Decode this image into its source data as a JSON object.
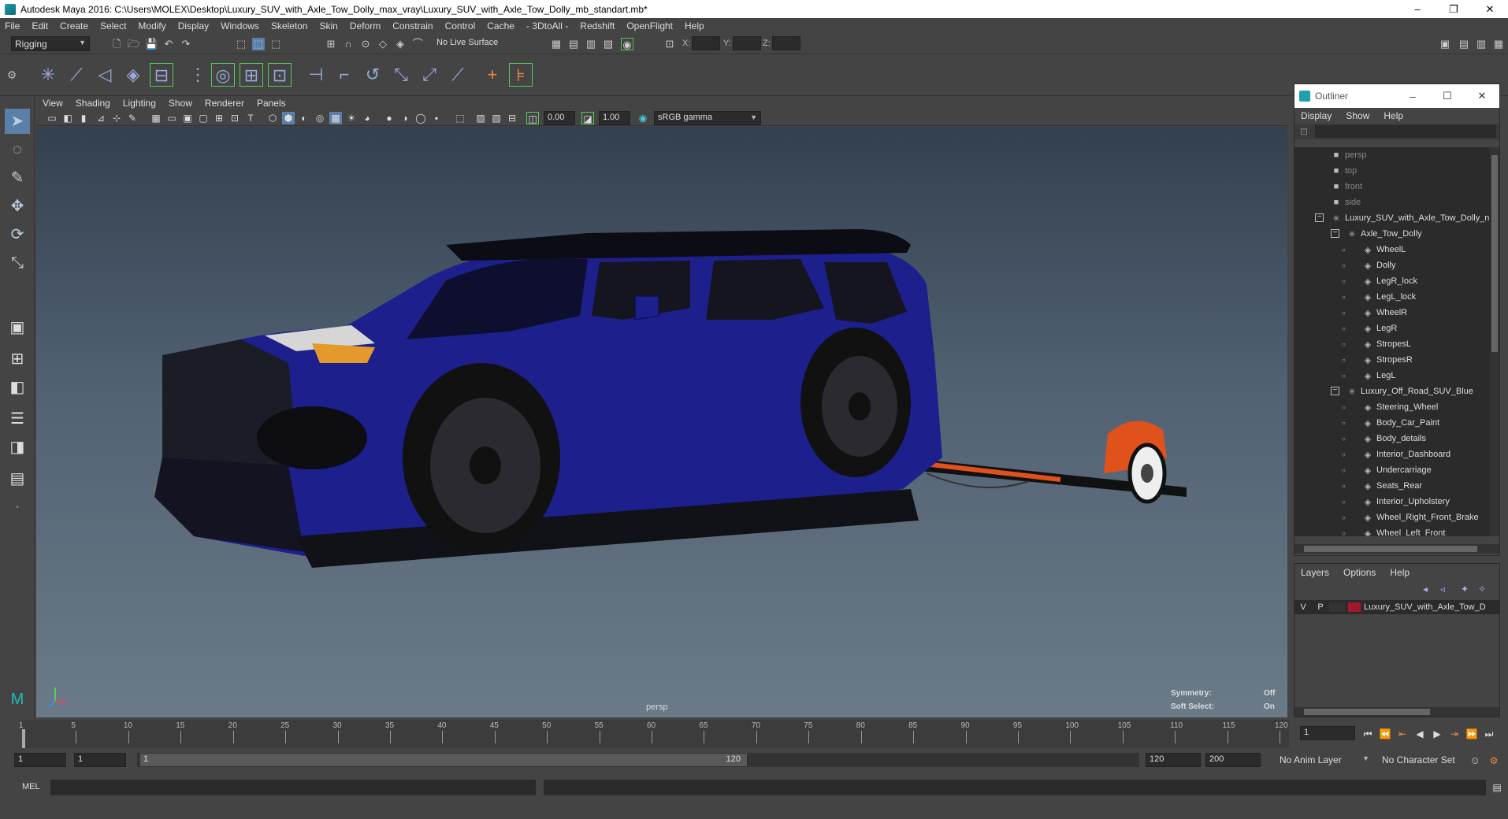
{
  "window": {
    "title": "Autodesk Maya 2016: C:\\Users\\MOLEX\\Desktop\\Luxury_SUV_with_Axle_Tow_Dolly_max_vray\\Luxury_SUV_with_Axle_Tow_Dolly_mb_standart.mb*",
    "minimize": "–",
    "maximize": "❐",
    "close": "✕"
  },
  "menubar": [
    "File",
    "Edit",
    "Create",
    "Select",
    "Modify",
    "Display",
    "Windows",
    "Skeleton",
    "Skin",
    "Deform",
    "Constrain",
    "Control",
    "Cache",
    "- 3DtoAll -",
    "Redshift",
    "OpenFlight",
    "Help"
  ],
  "statusline": {
    "mode": "Rigging",
    "live_surface": "No Live Surface",
    "x_label": "X:",
    "y_label": "Y:",
    "z_label": "Z:"
  },
  "panel": {
    "menu": [
      "View",
      "Shading",
      "Lighting",
      "Show",
      "Renderer",
      "Panels"
    ],
    "exposure": "0.00",
    "gamma": "1.00",
    "color_space": "sRGB gamma"
  },
  "viewport": {
    "camera": "persp",
    "symmetry_label": "Symmetry:",
    "symmetry_value": "Off",
    "soft_select_label": "Soft Select:",
    "soft_select_value": "On",
    "car_color": "#1d1f8c",
    "dolly_color": "#e0521b"
  },
  "outliner": {
    "title": "Outliner",
    "menu": [
      "Display",
      "Show",
      "Help"
    ],
    "items": [
      {
        "label": "persp",
        "type": "camera"
      },
      {
        "label": "top",
        "type": "camera"
      },
      {
        "label": "front",
        "type": "camera"
      },
      {
        "label": "side",
        "type": "camera"
      },
      {
        "label": "Luxury_SUV_with_Axle_Tow_Dolly_n",
        "type": "group"
      },
      {
        "label": "Axle_Tow_Dolly",
        "type": "group"
      },
      {
        "label": "WheelL",
        "type": "mesh"
      },
      {
        "label": "Dolly",
        "type": "mesh"
      },
      {
        "label": "LegR_lock",
        "type": "mesh"
      },
      {
        "label": "LegL_lock",
        "type": "mesh"
      },
      {
        "label": "WheelR",
        "type": "mesh"
      },
      {
        "label": "LegR",
        "type": "mesh"
      },
      {
        "label": "StropesL",
        "type": "mesh"
      },
      {
        "label": "StropesR",
        "type": "mesh"
      },
      {
        "label": "LegL",
        "type": "mesh"
      },
      {
        "label": "Luxury_Off_Road_SUV_Blue",
        "type": "group"
      },
      {
        "label": "Steering_Wheel",
        "type": "mesh"
      },
      {
        "label": "Body_Car_Paint",
        "type": "mesh"
      },
      {
        "label": "Body_details",
        "type": "mesh"
      },
      {
        "label": "Interior_Dashboard",
        "type": "mesh"
      },
      {
        "label": "Undercarriage",
        "type": "mesh"
      },
      {
        "label": "Seats_Rear",
        "type": "mesh"
      },
      {
        "label": "Interior_Upholstery",
        "type": "mesh"
      },
      {
        "label": "Wheel_Right_Front_Brake",
        "type": "mesh"
      },
      {
        "label": "Wheel_Left_Front",
        "type": "mesh"
      }
    ]
  },
  "layers": {
    "menu": [
      "Layers",
      "Options",
      "Help"
    ],
    "row": {
      "v": "V",
      "p": "P",
      "name": "Luxury_SUV_with_Axle_Tow_D",
      "color": "#a3182c"
    }
  },
  "timeline": {
    "ticks": [
      "1",
      "5",
      "10",
      "15",
      "20",
      "25",
      "30",
      "35",
      "40",
      "45",
      "50",
      "55",
      "60",
      "65",
      "70",
      "75",
      "80",
      "85",
      "90",
      "95",
      "100",
      "105",
      "110",
      "115",
      "120"
    ],
    "current_frame": "1"
  },
  "range": {
    "start": "1",
    "playback_start": "1",
    "slider_start": "1",
    "slider_end": "120",
    "playback_end": "120",
    "end": "200",
    "anim_layer": "No Anim Layer",
    "character_set": "No Character Set"
  },
  "cmdline": {
    "label": "MEL"
  }
}
